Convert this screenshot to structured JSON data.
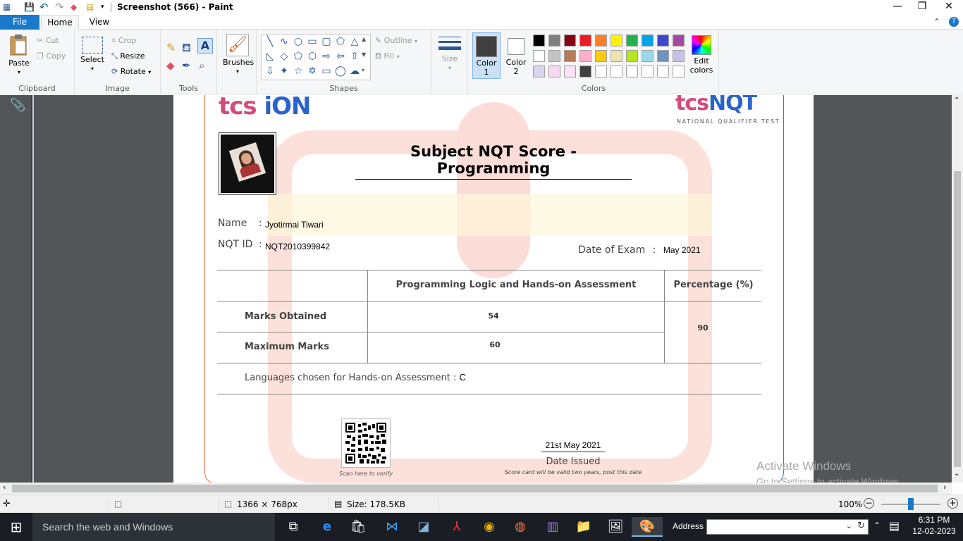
{
  "window": {
    "title": "Screenshot (566) - Paint",
    "controls": {
      "minimize": "—",
      "maximize": "❐",
      "close": "✕"
    }
  },
  "menu": {
    "file": "File",
    "home": "Home",
    "view": "View"
  },
  "ribbon": {
    "clipboard": {
      "label": "Clipboard",
      "paste": "Paste",
      "cut": "Cut",
      "copy": "Copy"
    },
    "image": {
      "label": "Image",
      "select": "Select",
      "crop": "Crop",
      "resize": "Resize",
      "rotate": "Rotate"
    },
    "tools": {
      "label": "Tools"
    },
    "brushes": {
      "label": "Brushes"
    },
    "shapes": {
      "label": "Shapes",
      "outline": "Outline",
      "fill": "Fill"
    },
    "size": {
      "label": "Size"
    },
    "colors": {
      "label": "Colors",
      "color1": "Color 1",
      "color1_line1": "Color",
      "color1_line2": "1",
      "color2_line1": "Color",
      "color2_line2": "2",
      "edit": "Edit colors",
      "edit_line1": "Edit",
      "edit_line2": "colors",
      "color1_value": "#404040",
      "color2_value": "#ffffff",
      "palette_row1": [
        "#000000",
        "#7f7f7f",
        "#880015",
        "#ed1c24",
        "#ff7f27",
        "#fff200",
        "#22b14c",
        "#00a2e8",
        "#3f48cc",
        "#a349a4"
      ],
      "palette_row2": [
        "#ffffff",
        "#c3c3c3",
        "#b97a57",
        "#ffaec9",
        "#ffc90e",
        "#efe4b0",
        "#b5e61d",
        "#99d9ea",
        "#7092be",
        "#c8bfe7"
      ],
      "palette_row3": [
        "#dcd3ef",
        "#f8d8f0",
        "#fbe3f7",
        "#404040",
        "#ffffff",
        "#ffffff",
        "#ffffff",
        "#ffffff",
        "#ffffff",
        "#ffffff"
      ]
    }
  },
  "document": {
    "brand_left_a": "tcs",
    "brand_left_b": "iON",
    "brand_right_a": "tcs",
    "brand_right_b": "NQT",
    "brand_right_sub": "NATIONAL QUALIFIER TEST",
    "heading": "Subject NQT Score - Programming",
    "name_label": "Name",
    "name_value": "Jyotirmai Tiwari",
    "id_label": "NQT ID",
    "id_value": "NQT2010399842",
    "exam_date_label": "Date of Exam",
    "exam_date_value": "May 2021",
    "colon": ":",
    "table": {
      "col_assessment": "Programming Logic and Hands-on Assessment",
      "col_percentage": "Percentage (%)",
      "row_obtained_label": "Marks Obtained",
      "row_obtained_value": "54",
      "row_max_label": "Maximum Marks",
      "row_max_value": "60",
      "percentage_value": "90"
    },
    "languages_label": "Languages chosen for Hands-on Assessment :",
    "languages_value": "C",
    "qr_caption": "Scan here to verify",
    "issue_date": "21st May 2021",
    "issue_label": "Date Issued",
    "validity_note": "Score card will be valid two years, post this date"
  },
  "activation": {
    "title": "Activate Windows",
    "subtitle": "Go to Settings to activate Windows."
  },
  "status": {
    "dimensions": "1366 × 768px",
    "size": "Size: 178.5KB",
    "zoom": "100%",
    "zoom_fraction": 0.5
  },
  "taskbar": {
    "search_placeholder": "Search the web and Windows",
    "address_label": "Address",
    "time": "6:31 PM",
    "date": "12-02-2023"
  }
}
